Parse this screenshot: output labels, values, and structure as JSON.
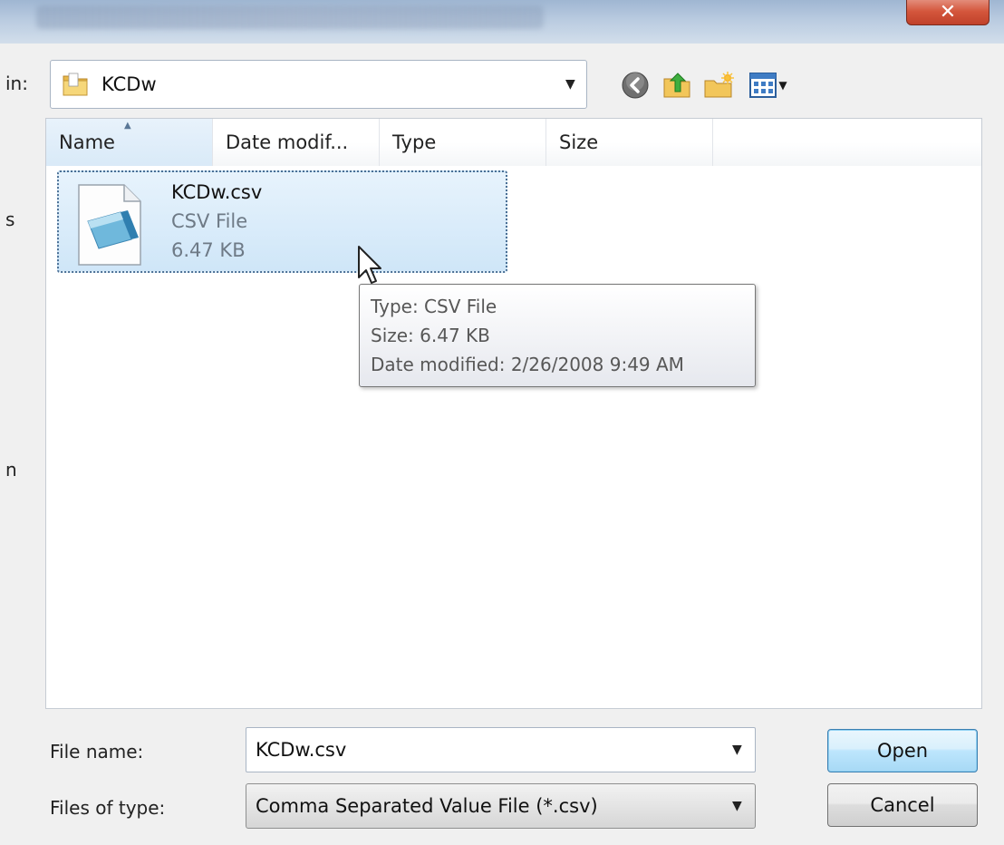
{
  "window": {
    "close_glyph": "✕"
  },
  "look_in": {
    "label": "in:",
    "value": "KCDw",
    "arrow": "▼"
  },
  "toolbar": {
    "icons": [
      "back-icon",
      "up-folder-icon",
      "new-folder-icon",
      "view-menu-icon"
    ],
    "view_arrow": "▼"
  },
  "columns": [
    {
      "label": "Name",
      "sorted": true
    },
    {
      "label": "Date modif..."
    },
    {
      "label": "Type"
    },
    {
      "label": "Size"
    }
  ],
  "files": [
    {
      "name": "KCDw.csv",
      "type": "CSV File",
      "size": "6.47 KB",
      "selected": true
    }
  ],
  "tooltip": {
    "type_line": "Type: CSV File",
    "size_line": "Size: 6.47 KB",
    "date_line": "Date modified: 2/26/2008 9:49 AM"
  },
  "sidebar_fragments": [
    "s",
    "n"
  ],
  "file_name": {
    "label": "File name:",
    "value": "KCDw.csv"
  },
  "file_type": {
    "label": "Files of type:",
    "value": "Comma Separated Value File (*.csv)"
  },
  "buttons": {
    "open": "Open",
    "cancel": "Cancel"
  },
  "colors": {
    "selection": "#cfe6f8",
    "accent_border": "#3c7fb1",
    "close_red": "#d4563c"
  }
}
